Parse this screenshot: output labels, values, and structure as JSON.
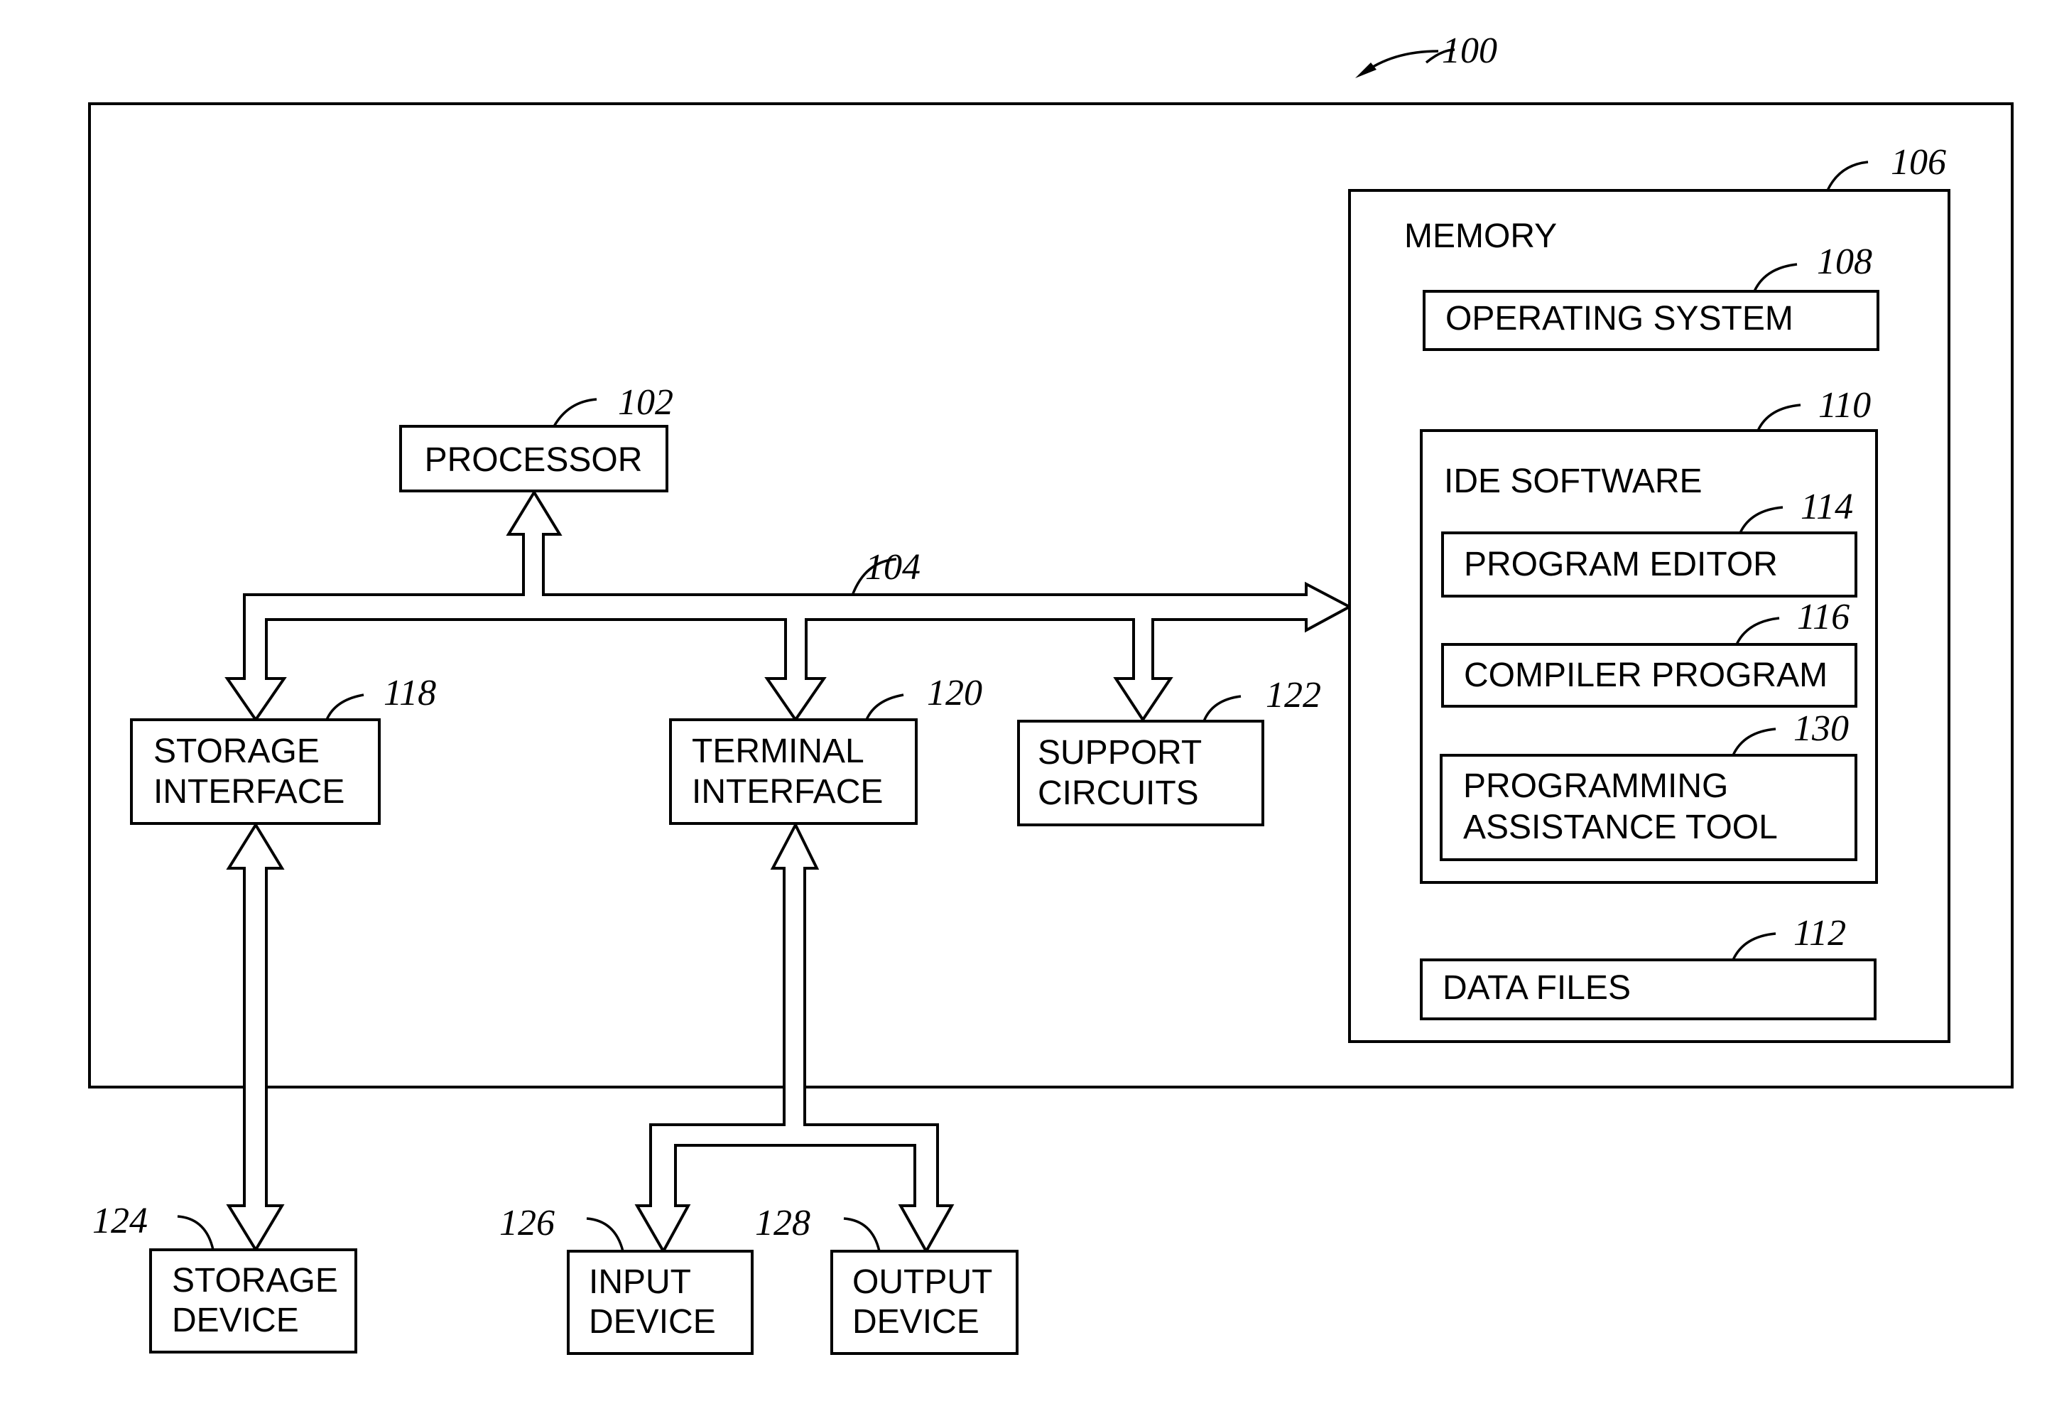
{
  "figure": {
    "ref": "100",
    "system_ref": "100"
  },
  "components": {
    "processor": {
      "label": [
        "PROCESSOR"
      ],
      "ref": "102"
    },
    "bus": {
      "ref": "104"
    },
    "memory": {
      "label": [
        "MEMORY"
      ],
      "ref": "106"
    },
    "operating_system": {
      "label": [
        "OPERATING SYSTEM"
      ],
      "ref": "108"
    },
    "ide_software": {
      "label": [
        "IDE SOFTWARE"
      ],
      "ref": "110"
    },
    "program_editor": {
      "label": [
        "PROGRAM EDITOR"
      ],
      "ref": "114"
    },
    "compiler_program": {
      "label": [
        "COMPILER PROGRAM"
      ],
      "ref": "116"
    },
    "programming_assistance_tool": {
      "label": [
        "PROGRAMMING",
        "ASSISTANCE TOOL"
      ],
      "ref": "130"
    },
    "data_files": {
      "label": [
        "DATA FILES"
      ],
      "ref": "112"
    },
    "storage_interface": {
      "label": [
        "STORAGE",
        "INTERFACE"
      ],
      "ref": "118"
    },
    "terminal_interface": {
      "label": [
        "TERMINAL",
        "INTERFACE"
      ],
      "ref": "120"
    },
    "support_circuits": {
      "label": [
        "SUPPORT",
        "CIRCUITS"
      ],
      "ref": "122"
    },
    "storage_device": {
      "label": [
        "STORAGE",
        "DEVICE"
      ],
      "ref": "124"
    },
    "input_device": {
      "label": [
        "INPUT",
        "DEVICE"
      ],
      "ref": "126"
    },
    "output_device": {
      "label": [
        "OUTPUT",
        "DEVICE"
      ],
      "ref": "128"
    }
  }
}
